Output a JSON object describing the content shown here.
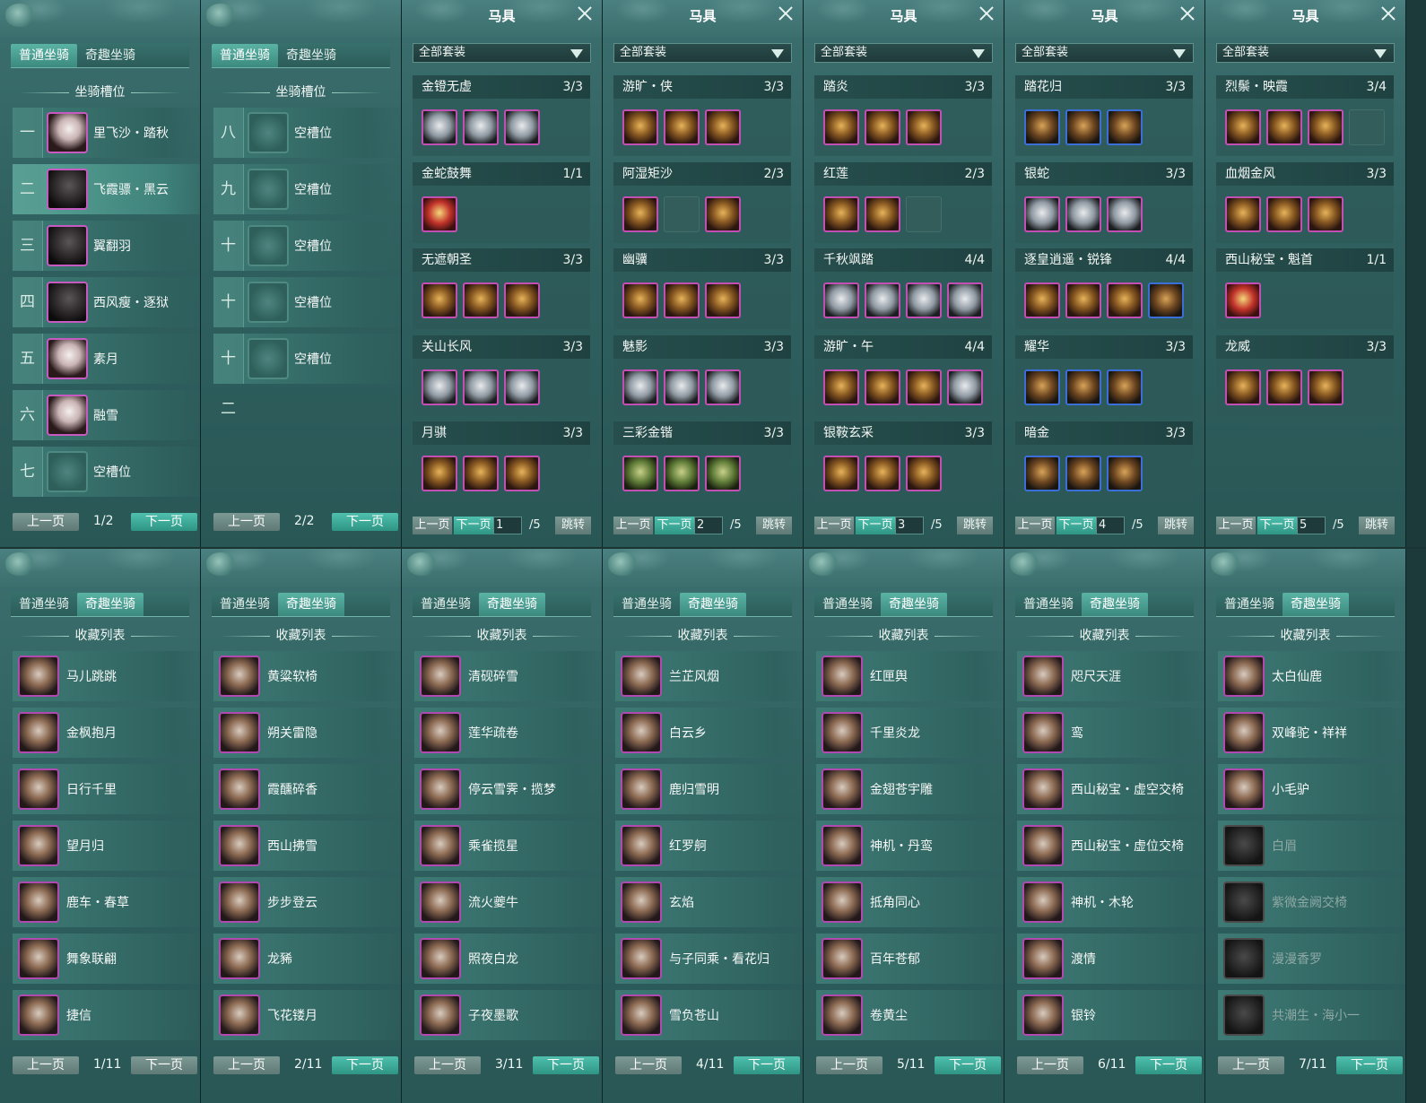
{
  "tabs": {
    "normal": "普通坐骑",
    "fun": "奇趣坐骑"
  },
  "slot_header": "坐骑槽位",
  "collection_header": "收藏列表",
  "prev": "上一页",
  "next": "下一页",
  "jump": "跳转",
  "gear_title": "马具",
  "gear_filter": "全部套装",
  "slot_panels": [
    {
      "page": "1/2",
      "rows": [
        {
          "num": "一",
          "name": "里飞沙・踏秋",
          "kind": "white"
        },
        {
          "num": "二",
          "name": "飞霞骠・黑云",
          "kind": "dark",
          "selected": true
        },
        {
          "num": "三",
          "name": "翼翻羽",
          "kind": "dark"
        },
        {
          "num": "四",
          "name": "西风瘦・逐狱",
          "kind": "dark"
        },
        {
          "num": "五",
          "name": "素月",
          "kind": "white"
        },
        {
          "num": "六",
          "name": "融雪",
          "kind": "white"
        },
        {
          "num": "七",
          "name": "空槽位",
          "kind": "empty"
        }
      ]
    },
    {
      "page": "2/2",
      "rows": [
        {
          "num": "八",
          "name": "空槽位",
          "kind": "empty"
        },
        {
          "num": "九",
          "name": "空槽位",
          "kind": "empty"
        },
        {
          "num": "十",
          "name": "空槽位",
          "kind": "empty"
        },
        {
          "num": "十一",
          "name": "空槽位",
          "kind": "empty"
        },
        {
          "num": "十二",
          "name": "空槽位",
          "kind": "empty"
        }
      ]
    }
  ],
  "gear_panels": [
    {
      "page": "1",
      "total": "/5",
      "sets": [
        {
          "name": "金镫无虚",
          "count": "3/3",
          "items": [
            "silver",
            "silver",
            "silver"
          ]
        },
        {
          "name": "金蛇鼓舞",
          "count": "1/1",
          "items": [
            "red"
          ]
        },
        {
          "name": "无遮朝圣",
          "count": "3/3",
          "items": [
            "gold",
            "gold",
            "gold"
          ]
        },
        {
          "name": "关山长风",
          "count": "3/3",
          "items": [
            "silver",
            "silver",
            "silver"
          ]
        },
        {
          "name": "月骐",
          "count": "3/3",
          "items": [
            "gold",
            "gold",
            "gold"
          ]
        }
      ]
    },
    {
      "page": "2",
      "total": "/5",
      "sets": [
        {
          "name": "游旷・侠",
          "count": "3/3",
          "items": [
            "gold",
            "gold",
            "gold"
          ]
        },
        {
          "name": "阿湿矩沙",
          "count": "2/3",
          "items": [
            "gold",
            "empty",
            "gold"
          ]
        },
        {
          "name": "幽骥",
          "count": "3/3",
          "items": [
            "gold",
            "gold",
            "gold"
          ]
        },
        {
          "name": "魅影",
          "count": "3/3",
          "items": [
            "silver",
            "silver",
            "silver"
          ]
        },
        {
          "name": "三彩金锴",
          "count": "3/3",
          "items": [
            "green",
            "green",
            "green"
          ]
        }
      ]
    },
    {
      "page": "3",
      "total": "/5",
      "sets": [
        {
          "name": "踏炎",
          "count": "3/3",
          "items": [
            "gold",
            "gold",
            "gold"
          ]
        },
        {
          "name": "红莲",
          "count": "2/3",
          "items": [
            "gold",
            "gold",
            "empty"
          ]
        },
        {
          "name": "千秋飒踏",
          "count": "4/4",
          "items": [
            "silver",
            "silver",
            "silver",
            "silver"
          ]
        },
        {
          "name": "游旷・午",
          "count": "4/4",
          "items": [
            "gold",
            "gold",
            "gold",
            "silver"
          ]
        },
        {
          "name": "银鞍玄采",
          "count": "3/3",
          "items": [
            "gold",
            "gold",
            "gold"
          ]
        }
      ]
    },
    {
      "page": "4",
      "total": "/5",
      "sets": [
        {
          "name": "踏花归",
          "count": "3/3",
          "items": [
            "blue",
            "blue",
            "blue"
          ]
        },
        {
          "name": "银蛇",
          "count": "3/3",
          "items": [
            "silver",
            "silver",
            "silver"
          ]
        },
        {
          "name": "逐皇逍遥・锐锋",
          "count": "4/4",
          "items": [
            "gold",
            "gold",
            "gold",
            "blue"
          ]
        },
        {
          "name": "耀华",
          "count": "3/3",
          "items": [
            "blue",
            "blue",
            "blue"
          ]
        },
        {
          "name": "暗金",
          "count": "3/3",
          "items": [
            "blue",
            "blue",
            "blue"
          ]
        }
      ]
    },
    {
      "page": "5",
      "total": "/5",
      "sets": [
        {
          "name": "烈鬃・映霞",
          "count": "3/4",
          "items": [
            "gold",
            "gold",
            "gold",
            "empty"
          ]
        },
        {
          "name": "血烟金风",
          "count": "3/3",
          "items": [
            "gold",
            "gold",
            "gold"
          ]
        },
        {
          "name": "西山秘宝・魁首",
          "count": "1/1",
          "items": [
            "red"
          ]
        },
        {
          "name": "龙威",
          "count": "3/3",
          "items": [
            "gold",
            "gold",
            "gold"
          ]
        }
      ]
    }
  ],
  "collection_panels": [
    {
      "page": "1/11",
      "rows": [
        {
          "name": "马儿跳跳"
        },
        {
          "name": "金枫抱月"
        },
        {
          "name": "日行千里"
        },
        {
          "name": "望月归"
        },
        {
          "name": "鹿车・春草"
        },
        {
          "name": "舞象联翩"
        },
        {
          "name": "捷信"
        }
      ]
    },
    {
      "page": "2/11",
      "rows": [
        {
          "name": "黄粱软椅"
        },
        {
          "name": "朔关雷隐"
        },
        {
          "name": "霞醺碎香"
        },
        {
          "name": "西山拂雪"
        },
        {
          "name": "步步登云"
        },
        {
          "name": "龙豨"
        },
        {
          "name": "飞花镂月"
        }
      ]
    },
    {
      "page": "3/11",
      "rows": [
        {
          "name": "清砚碎雪"
        },
        {
          "name": "莲华疏卷"
        },
        {
          "name": "停云雪霁・揽梦"
        },
        {
          "name": "乘雀揽星"
        },
        {
          "name": "流火夔牛"
        },
        {
          "name": "照夜白龙"
        },
        {
          "name": "子夜墨歌"
        }
      ]
    },
    {
      "page": "4/11",
      "rows": [
        {
          "name": "兰芷风烟"
        },
        {
          "name": "白云乡"
        },
        {
          "name": "鹿归雪明"
        },
        {
          "name": "红罗舸"
        },
        {
          "name": "玄焰"
        },
        {
          "name": "与子同乘・看花归"
        },
        {
          "name": "雪负苍山"
        }
      ]
    },
    {
      "page": "5/11",
      "rows": [
        {
          "name": "红匣舆"
        },
        {
          "name": "千里炎龙"
        },
        {
          "name": "金翅苍宇雕"
        },
        {
          "name": "神机・丹鸾"
        },
        {
          "name": "抵角同心"
        },
        {
          "name": "百年苍郁"
        },
        {
          "name": "卷黄尘"
        }
      ]
    },
    {
      "page": "6/11",
      "rows": [
        {
          "name": "咫尺天涯"
        },
        {
          "name": "鸾"
        },
        {
          "name": "西山秘宝・虚空交椅"
        },
        {
          "name": "西山秘宝・虚位交椅"
        },
        {
          "name": "神机・木轮"
        },
        {
          "name": "渡情"
        },
        {
          "name": "银铃"
        }
      ]
    },
    {
      "page": "7/11",
      "rows": [
        {
          "name": "太白仙鹿"
        },
        {
          "name": "双峰驼・祥祥"
        },
        {
          "name": "小毛驴"
        },
        {
          "name": "白眉",
          "dim": true
        },
        {
          "name": "紫微金阙交椅",
          "dim": true
        },
        {
          "name": "漫漫香罗",
          "dim": true
        },
        {
          "name": "共潮生・海小一",
          "dim": true
        }
      ]
    }
  ]
}
